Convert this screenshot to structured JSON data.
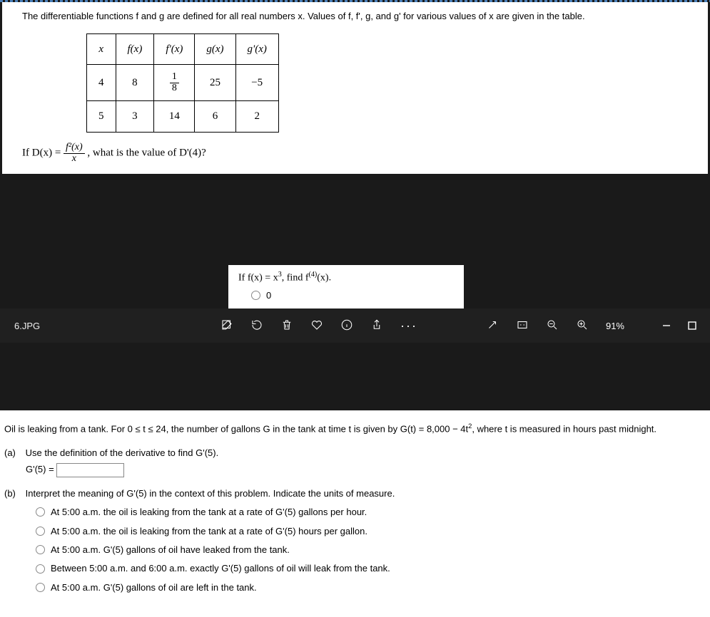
{
  "problem1": {
    "prompt": "The differentiable functions f and g are defined for all real numbers x. Values of f, f', g, and g' for various values of x are given in the table.",
    "headers": [
      "x",
      "f(x)",
      "f'(x)",
      "g(x)",
      "g'(x)"
    ],
    "rows": [
      [
        "4",
        "8",
        "1/8",
        "25",
        "−5"
      ],
      [
        "5",
        "3",
        "14",
        "6",
        "2"
      ]
    ],
    "question_pre": "If D(x) = ",
    "frac_num": "f²(x)",
    "frac_den": "x",
    "question_post": ", what is the value of D'(4)?"
  },
  "mid": {
    "line1_pre": "If f(x) = x",
    "line1_exp": "3",
    "line1_mid": ", find f",
    "line1_exp2": "(4)",
    "line1_post": "(x).",
    "opt0": "0"
  },
  "toolbar": {
    "filename": "6.JPG",
    "zoom": "91%"
  },
  "problem2": {
    "stem_pre": "Oil is leaking from a tank. For 0 ≤ t ≤ 24, the number of gallons G in the tank at time t is given by G(t) = 8,000 − 4t",
    "stem_exp": "2",
    "stem_post": ", where t is measured in hours past midnight.",
    "partA_label": "(a)",
    "partA_text": "Use the definition of the derivative to find G'(5).",
    "partA_answer_label": "G'(5) = ",
    "partB_label": "(b)",
    "partB_text": "Interpret the meaning of G'(5) in the context of this problem. Indicate the units of measure.",
    "options": [
      "At 5:00 a.m. the oil is leaking from the tank at a rate of G'(5) gallons per hour.",
      "At 5:00 a.m. the oil is leaking from the tank at a rate of G'(5) hours per gallon.",
      "At 5:00 a.m. G'(5) gallons of oil have leaked from the tank.",
      "Between 5:00 a.m. and 6:00 a.m. exactly G'(5) gallons of oil will leak from the tank.",
      "At 5:00 a.m. G'(5) gallons of oil are left in the tank."
    ]
  }
}
